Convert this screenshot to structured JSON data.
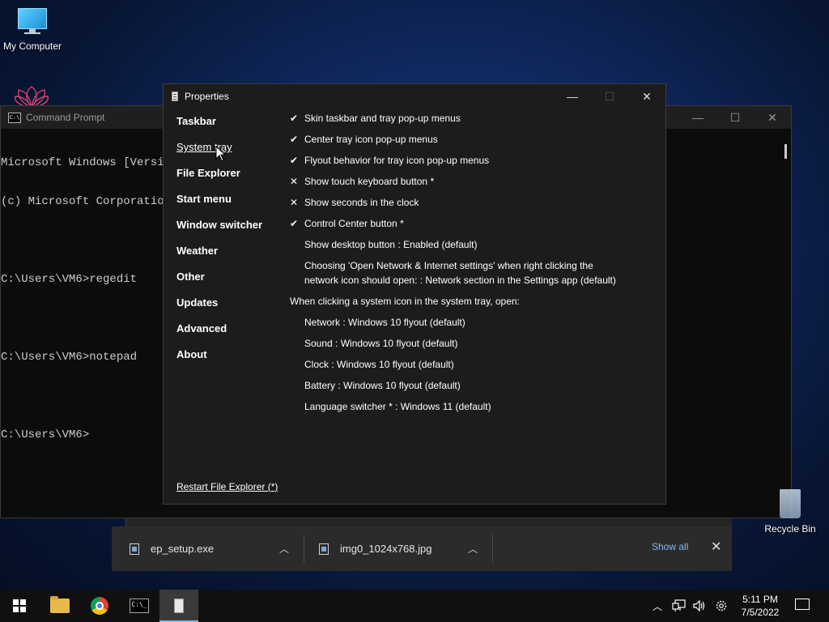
{
  "desktop": {
    "my_computer_label": "My Computer",
    "recycle_bin_label": "Recycle Bin"
  },
  "cmd": {
    "title": "Command Prompt",
    "lines": [
      "Microsoft Windows [Versio",
      "(c) Microsoft Corporation",
      "",
      "C:\\Users\\VM6>regedit",
      "",
      "C:\\Users\\VM6>notepad",
      "",
      "C:\\Users\\VM6>"
    ],
    "minimize": "—",
    "maximize": "☐",
    "close": "✕"
  },
  "properties": {
    "title": "Properties",
    "minimize": "—",
    "maximize": "☐",
    "close": "✕",
    "nav": [
      {
        "label": "Taskbar",
        "active": false
      },
      {
        "label": "System tray",
        "active": true
      },
      {
        "label": "File Explorer",
        "active": false
      },
      {
        "label": "Start menu",
        "active": false
      },
      {
        "label": "Window switcher",
        "active": false
      },
      {
        "label": "Weather",
        "active": false
      },
      {
        "label": "Other",
        "active": false
      },
      {
        "label": "Updates",
        "active": false
      },
      {
        "label": "Advanced",
        "active": false
      },
      {
        "label": "About",
        "active": false
      }
    ],
    "options": [
      {
        "mark": "✔",
        "label": "Skin taskbar and tray pop-up menus"
      },
      {
        "mark": "✔",
        "label": "Center tray icon pop-up menus"
      },
      {
        "mark": "✔",
        "label": "Flyout behavior for tray icon pop-up menus"
      },
      {
        "mark": "✕",
        "label": "Show touch keyboard button *"
      },
      {
        "mark": "✕",
        "label": "Show seconds in the clock"
      },
      {
        "mark": "✔",
        "label": "Control Center button *"
      },
      {
        "mark": "",
        "label": "Show desktop button : Enabled (default)"
      },
      {
        "mark": "",
        "label": "Choosing 'Open Network & Internet settings' when right clicking the network icon should open: : Network section in the Settings app (default)"
      }
    ],
    "section_header": "When clicking a system icon in the system tray, open:",
    "sub_options": [
      "Network : Windows 10 flyout (default)",
      "Sound : Windows 10 flyout (default)",
      "Clock : Windows 10 flyout (default)",
      "Battery : Windows 10 flyout (default)",
      "Language switcher * : Windows 11 (default)"
    ],
    "restart_link": "Restart File Explorer (*)"
  },
  "downloads": {
    "items": [
      "ep_setup.exe",
      "img0_1024x768.jpg"
    ],
    "show_all": "Show all",
    "close": "✕",
    "chevron": "︿"
  },
  "taskbar": {
    "time": "5:11 PM",
    "date": "7/5/2022",
    "tray_chevron": "︿"
  },
  "colors": {
    "accent": "#76b9ed",
    "link": "#8ab4f8"
  }
}
